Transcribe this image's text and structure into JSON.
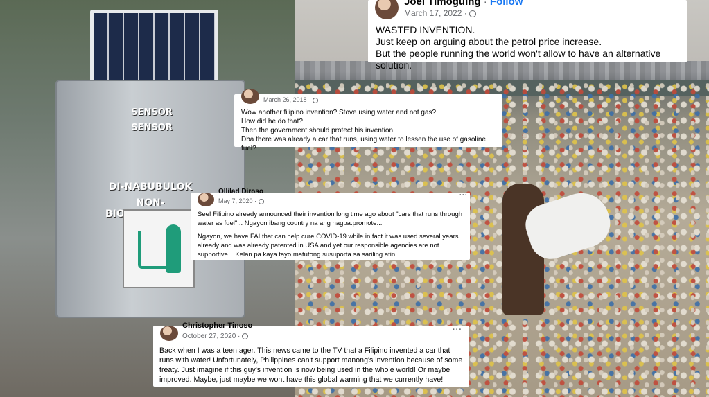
{
  "left_photo": {
    "kiosk_labels": [
      "SENSOR",
      "SENSOR"
    ],
    "sign_top": "DI-NABUBULOK",
    "sign_bottom": "NON-BIODEGRADABLE"
  },
  "posts": [
    {
      "author": "Joel Timoguing",
      "separator": "·",
      "follow_label": "Follow",
      "date": "March 17, 2022 ·",
      "body": [
        "WASTED INVENTION.",
        "Just keep on arguing about the petrol price increase.",
        "But the people running the world won't allow to have an alternative solution."
      ]
    },
    {
      "date": "March 26, 2018 ·",
      "body": [
        "Wow another filipino invention? Stove using water and not gas?",
        "How did he do that?",
        "Then the government should protect his invention.",
        "Dba there was already a car that runs, using water to lessen the use of gasoline fuel?"
      ]
    },
    {
      "author": "Ollilad Diroso",
      "date": "May 7, 2020 ·",
      "menu": "···",
      "body": [
        "See! Filipino already announced their invention long time ago about \"cars that runs through water as fuel\"... Ngayon ibang country na ang nagpa.promote...",
        "Ngayon, we have FAI that can help cure COVID-19 while in fact it was used several years already and was already patented in USA and yet our responsible agencies are not supportive... Kelan pa kaya tayo matutong susuporta sa sariling atin..."
      ]
    },
    {
      "author": "Christopher Tinoso",
      "date": "October 27, 2020 ·",
      "menu": "···",
      "body": [
        "Back when I was a teen ager. This news came to the TV that a Filipino invented a car that runs with water! Unfortunately, Philippines can't support manong's invention because of some treaty. Just imagine if this guy's invention is now being used in the whole world! Or maybe improved. Maybe, just maybe we wont have this global warming that we currently have!"
      ]
    }
  ],
  "colors": {
    "link": "#1877f2",
    "meta": "#65676b",
    "card_bg": "#ffffff"
  }
}
